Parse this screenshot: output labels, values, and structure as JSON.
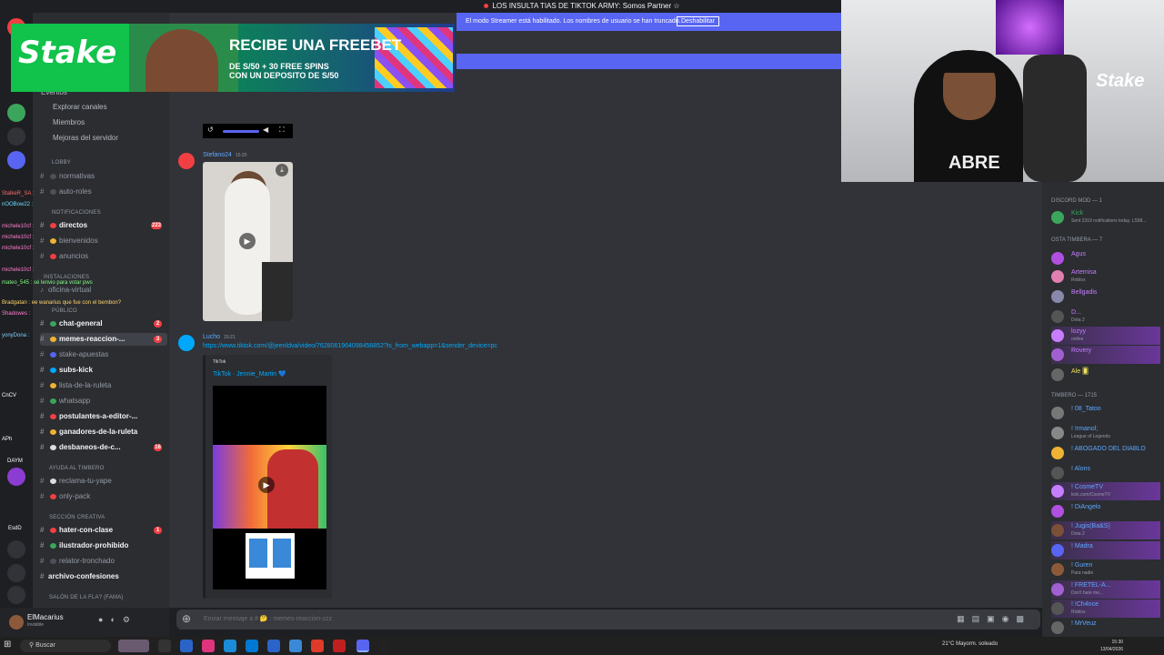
{
  "top_bar": {
    "title": "LOS INSULTA TIAS DE TIKTOK ARMY: Somos Partner ☆"
  },
  "streamer_notice": {
    "text": "El modo Streamer está habilitado. Los nombres de usuario se han truncado.",
    "button": "Deshabilitar"
  },
  "ad": {
    "logo": "Stake",
    "headline": "RECIBE UNA FREEBET",
    "subline": "DE S/50 + 30 FREE SPINS",
    "subline2": "CON UN DEPOSITO DE S/50"
  },
  "webcam": {
    "shirt": "ABRE",
    "watermark": "Stake"
  },
  "nav": {
    "events": "Eventos",
    "browse": "Explorar canales",
    "members": "Miembros",
    "boosts": "Mejoras del servidor"
  },
  "categories": {
    "lobby": "LOBBY",
    "notifications": "NOTIFICACIONES",
    "installations": "INSTALACIONES",
    "public": "PÚBLICO",
    "help": "AYUDA AL TIMBERO",
    "creative": "SECCIÓN CREATIVA",
    "hall": "SALÓN DE LA FLA? (FAMA)"
  },
  "channels": [
    {
      "name": "normativas",
      "bold": false,
      "badge": ""
    },
    {
      "name": "auto-roles",
      "bold": false,
      "badge": ""
    },
    {
      "name": "directos",
      "bold": true,
      "badge": "223"
    },
    {
      "name": "bienvenidos",
      "bold": false,
      "badge": ""
    },
    {
      "name": "anuncios",
      "bold": false,
      "badge": ""
    },
    {
      "name": "oficina-virtual",
      "bold": false,
      "badge": ""
    },
    {
      "name": "chat-general",
      "bold": true,
      "badge": "2"
    },
    {
      "name": "memes-reaccion-...",
      "bold": true,
      "badge": "3"
    },
    {
      "name": "stake-apuestas",
      "bold": false,
      "badge": ""
    },
    {
      "name": "subs-kick",
      "bold": true,
      "badge": ""
    },
    {
      "name": "lista-de-la-ruleta",
      "bold": false,
      "badge": ""
    },
    {
      "name": "whatsapp",
      "bold": false,
      "badge": ""
    },
    {
      "name": "postulantes-a-editor-...",
      "bold": true,
      "badge": ""
    },
    {
      "name": "ganadores-de-la-ruleta",
      "bold": true,
      "badge": ""
    },
    {
      "name": "desbaneos-de-c...",
      "bold": true,
      "badge": "16"
    },
    {
      "name": "reclama-tu-yape",
      "bold": false,
      "badge": ""
    },
    {
      "name": "only-pack",
      "bold": false,
      "badge": ""
    },
    {
      "name": "hater-con-clase",
      "bold": true,
      "badge": "1"
    },
    {
      "name": "ilustrador-prohibido",
      "bold": true,
      "badge": ""
    },
    {
      "name": "relator-tronchado",
      "bold": false,
      "badge": ""
    },
    {
      "name": "archivo-confesiones",
      "bold": true,
      "badge": ""
    }
  ],
  "chat_overlay": [
    "StalkeR_SA :",
    "nOOBow22 :",
    "michele10cf :",
    "michele10cf :",
    "michele10cf :",
    "michele10cf :",
    "mateo_545 : sé lenvio para votar pws",
    "Bradgatan : ee wanarius que fue con el bembon?",
    "Shadowes :",
    "yonyDona :",
    "CnCV",
    "APh",
    "DAYM",
    "EsdD"
  ],
  "messages": [
    {
      "author": "Stefano24",
      "time": "15:20"
    },
    {
      "author": "Lucho",
      "time": "15:21",
      "link": "https://www.tiktok.com/@jeenldva/video/7628061964098456852?is_from_webapp=1&sender_device=pc"
    }
  ],
  "embed": {
    "provider": "TikTok",
    "title": "TikTok · Jennie_Martin 💙"
  },
  "composer": {
    "placeholder": "Enviar mensaje a #  🤔 : memes-reaccion-zzz"
  },
  "user": {
    "name": "ElMacarius",
    "status": "Invisible"
  },
  "member_groups": {
    "mod": "DISCORD MOD — 1",
    "staff": "OSTA TIMBERA — 7",
    "timbero": "TIMBERO — 1715"
  },
  "members": [
    {
      "name": "Kick",
      "sub": "Sent 2319 notifications today. LS58..."
    },
    {
      "name": "Agus",
      "sub": ""
    },
    {
      "name": "Artemisa",
      "sub": "Roblox"
    },
    {
      "name": "Bellgadis",
      "sub": ""
    },
    {
      "name": "D...",
      "sub": "Dota 2"
    },
    {
      "name": "lozyy",
      "sub": "online"
    },
    {
      "name": "Rovery",
      "sub": ""
    },
    {
      "name": "Ale 🂠",
      "sub": ""
    },
    {
      "name": "! 08_Tatoo",
      "sub": ""
    },
    {
      "name": "! !rmanol;",
      "sub": "League of Legends"
    },
    {
      "name": "! ABOGADO DEL DIABLO",
      "sub": ""
    },
    {
      "name": "! Alons",
      "sub": ""
    },
    {
      "name": "! CosmeTV",
      "sub": "kick.com/CosmeTV"
    },
    {
      "name": "! DiAngelo",
      "sub": ""
    },
    {
      "name": "! Jugis(Ba&S)",
      "sub": "Dota 2"
    },
    {
      "name": "! Madra",
      "sub": ""
    },
    {
      "name": "! Guren",
      "sub": "Para nadie"
    },
    {
      "name": "! FRETEL-A...",
      "sub": "Don't hate me..."
    },
    {
      "name": "! !Ch4nce",
      "sub": "Roblox"
    },
    {
      "name": "! MrVeuz",
      "sub": ""
    }
  ],
  "taskbar": {
    "search": "Buscar",
    "weather": "21°C  Mayorm. soleado",
    "time": "15:30",
    "date": "13/04/2026"
  },
  "colors": {
    "blurple": "#5865f2",
    "red": "#f23f43",
    "link": "#00a8fc"
  }
}
